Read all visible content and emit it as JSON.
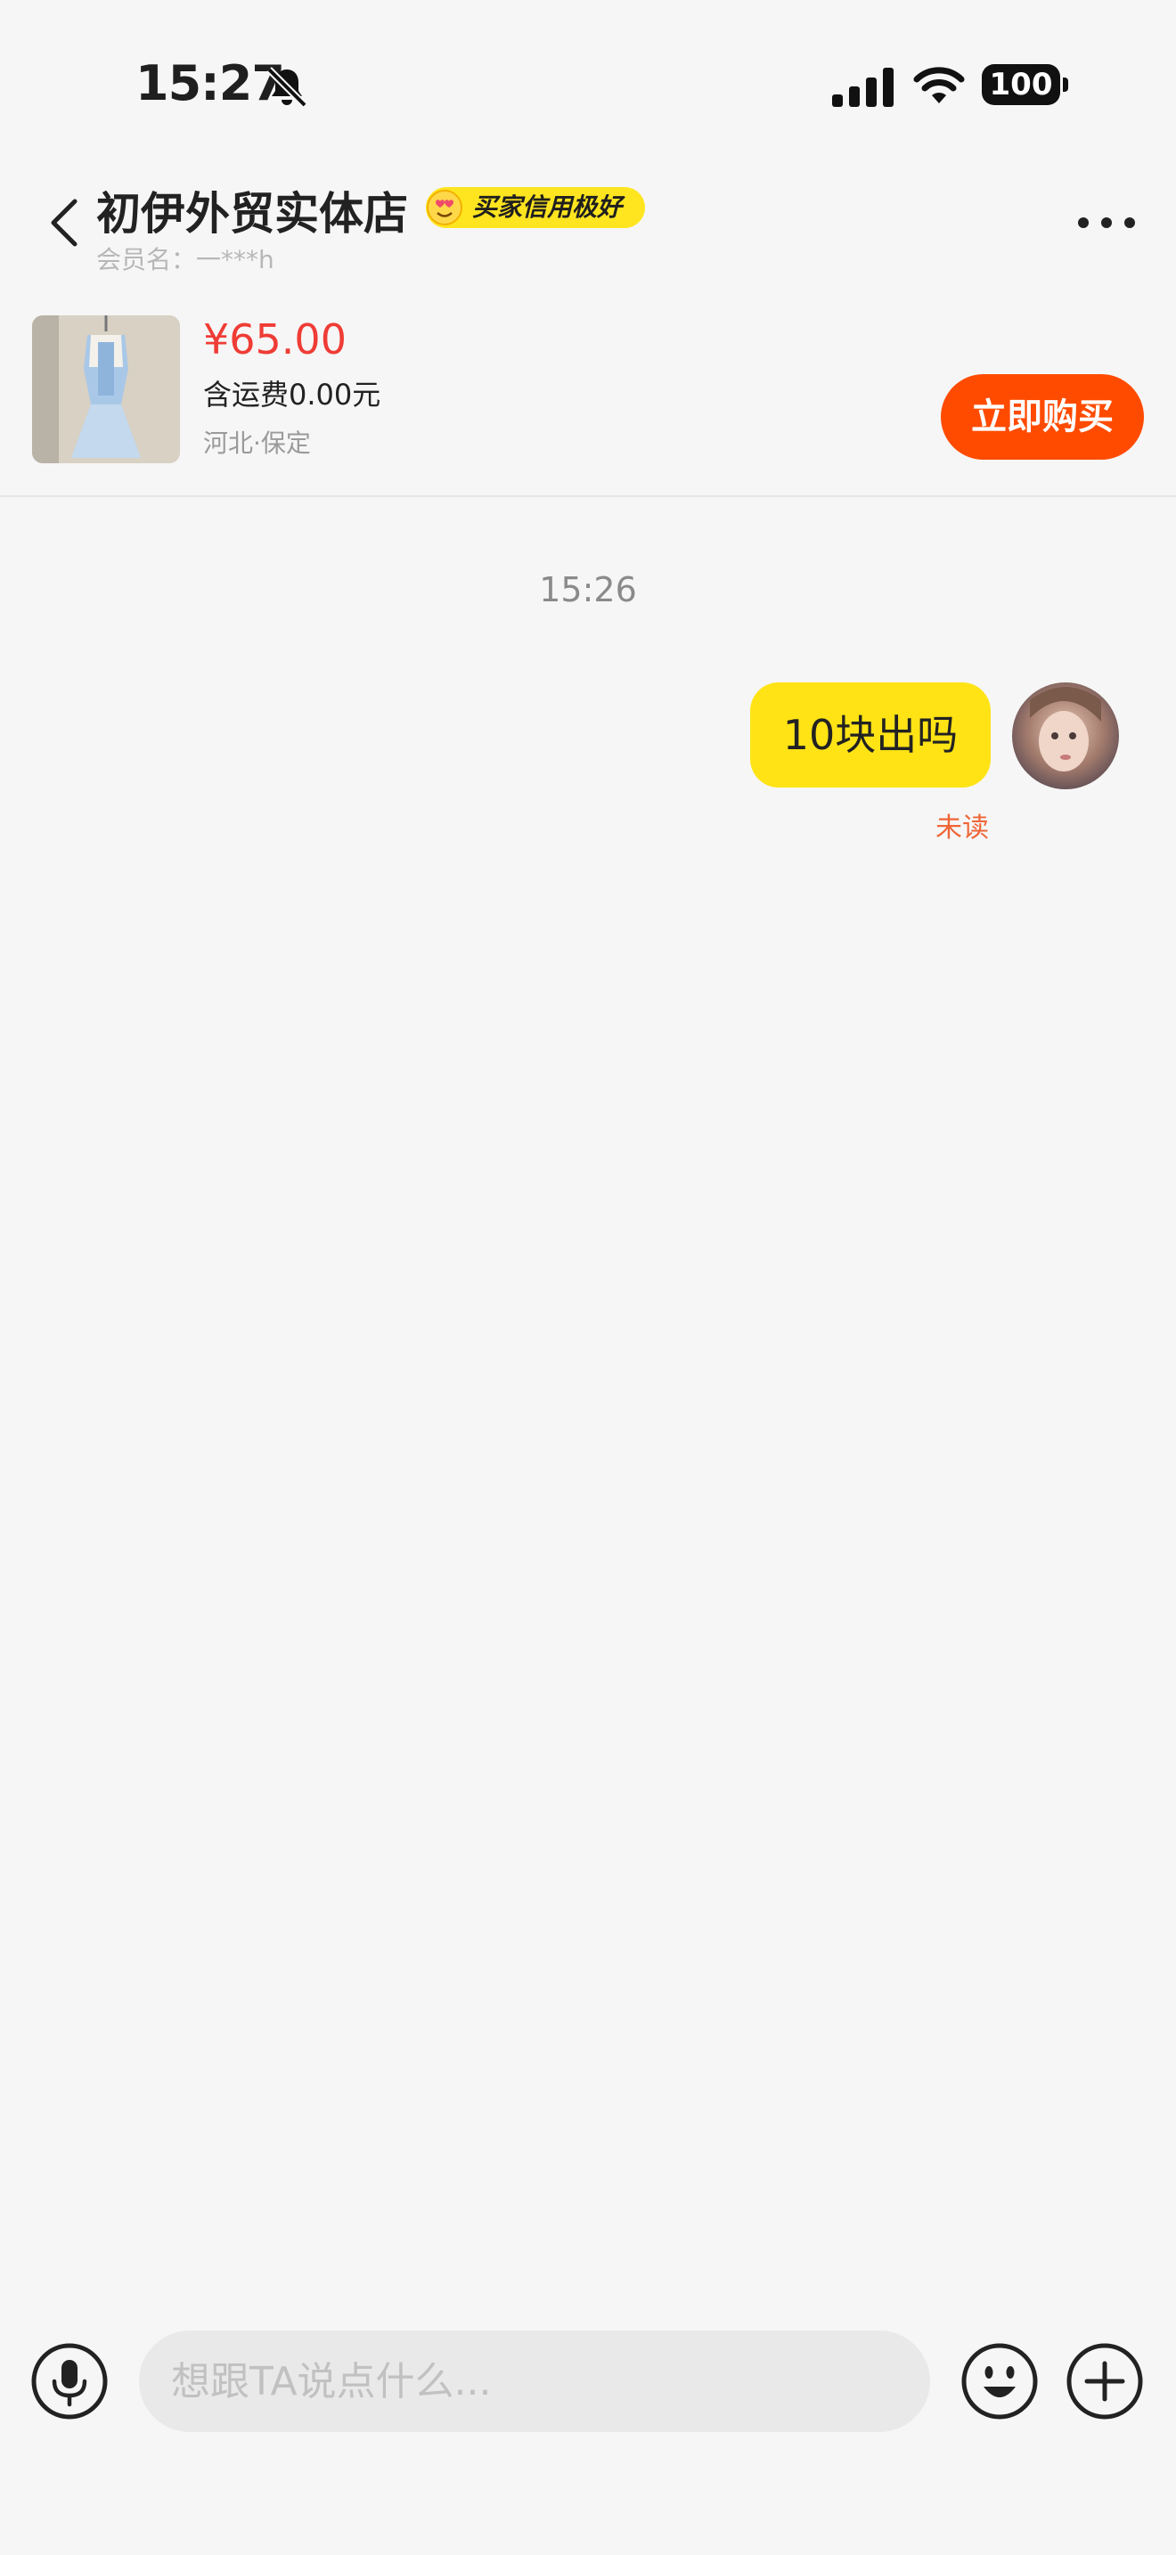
{
  "status_bar": {
    "time": "15:27",
    "battery": "100",
    "icons": [
      "bell-slash-icon",
      "cellular-signal-icon",
      "wifi-icon",
      "battery-icon"
    ]
  },
  "header": {
    "shop_name": "初伊外贸实体店",
    "credit_badge": "买家信用极好",
    "member_name": "会员名：一***h",
    "icons": [
      "back-chevron-icon",
      "more-dots-icon",
      "heart-eyes-face-icon"
    ]
  },
  "product": {
    "price": "¥65.00",
    "shipping": "含运费0.00元",
    "location": "河北·保定",
    "buy_label": "立即购买"
  },
  "chat": {
    "timestamp": "15:26",
    "messages": [
      {
        "text": "10块出吗",
        "status": "未读",
        "from": "me"
      }
    ]
  },
  "input_bar": {
    "placeholder": "想跟TA说点什么...",
    "icons": [
      "microphone-icon",
      "emoji-icon",
      "plus-icon"
    ]
  },
  "colors": {
    "background": "#f6f6f6",
    "accent_yellow": "#ffe315",
    "buy_orange": "#ff4b00",
    "price_red": "#ef3c35",
    "unread_orange": "#ef6536"
  }
}
